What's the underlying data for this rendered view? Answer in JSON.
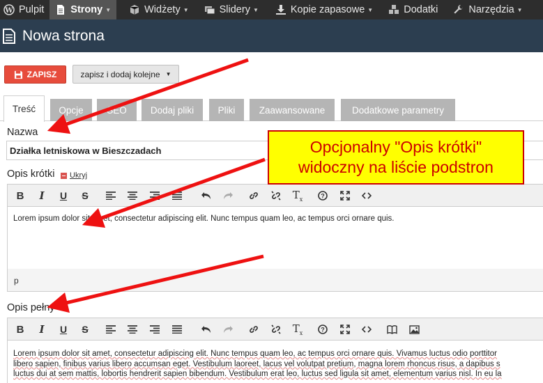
{
  "nav": {
    "items": [
      {
        "label": "Pulpit",
        "icon": "wordpress-icon",
        "active": false,
        "caret": false
      },
      {
        "label": "Strony",
        "icon": "document-icon",
        "active": true,
        "caret": true
      },
      {
        "label": "Widżety",
        "icon": "cube-icon",
        "active": false,
        "caret": true
      },
      {
        "label": "Slidery",
        "icon": "slides-icon",
        "active": false,
        "caret": true
      },
      {
        "label": "Kopie zapasowe",
        "icon": "download-icon",
        "active": false,
        "caret": true
      },
      {
        "label": "Dodatki",
        "icon": "cubes-icon",
        "active": false,
        "caret": false
      },
      {
        "label": "Narzędzia",
        "icon": "wrench-icon",
        "active": false,
        "caret": true
      }
    ]
  },
  "page": {
    "title": "Nowa strona"
  },
  "actions": {
    "save_label": "ZAPISZ",
    "save_next_label": "zapisz i dodaj kolejne"
  },
  "tabs": [
    "Treść",
    "Opcje",
    "SEO",
    "Dodaj pliki",
    "Pliki",
    "Zaawansowane",
    "Dodatkowe parametry"
  ],
  "form": {
    "name_label": "Nazwa",
    "name_value": "Działka letniskowa w Bieszczadach",
    "short_label": "Opis krótki",
    "hide_label": "Ukryj",
    "short_text": "Lorem ipsum dolor sit amet, consectetur adipiscing elit. Nunc tempus quam leo, ac tempus orci ornare quis.",
    "short_status": "p",
    "full_label": "Opis pełny",
    "full_lines": [
      "Lorem ipsum dolor sit amet, consectetur adipiscing elit. Nunc tempus quam leo, ac tempus orci ornare quis. Vivamus luctus odio porttitor",
      "libero sapien, finibus varius libero accumsan eget. Vestibulum laoreet, lacus vel volutpat pretium, magna lorem rhoncus risus, a dapibus s",
      "luctus dui at sem mattis, lobortis hendrerit sapien bibendum. Vestibulum erat leo, luctus sed ligula sit amet, elementum varius nisl. In eu la"
    ]
  },
  "callout": {
    "line1": "Opcjonalny \"Opis krótki\"",
    "line2": "widoczny na liście podstron"
  },
  "toolbar_icons": {
    "short": [
      "bold-icon",
      "italic-icon",
      "underline-icon",
      "strikethrough-icon",
      "align-left-icon",
      "align-center-icon",
      "align-right-icon",
      "align-justify-icon",
      "undo-icon",
      "redo-icon",
      "link-icon",
      "unlink-icon",
      "clear-format-icon",
      "help-icon",
      "fullscreen-icon",
      "source-code-icon"
    ],
    "full_extra": [
      "book-icon",
      "image-icon"
    ]
  },
  "colors": {
    "accent": "#e74c3c",
    "header": "#2c3e50",
    "nav": "#2d2d2d",
    "callout_bg": "#ffff00",
    "callout_fg": "#cc0000"
  }
}
